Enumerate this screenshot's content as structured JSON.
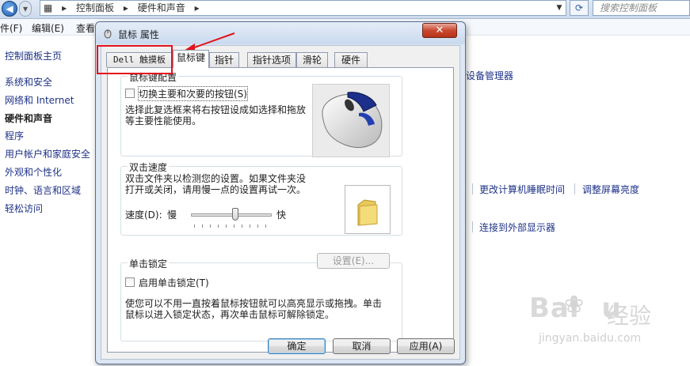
{
  "explorer": {
    "address_segments": [
      "控制面板",
      "▸",
      "硬件和声音",
      "▸"
    ],
    "search_placeholder": "搜索控制面板",
    "menu": [
      "件(F)",
      "编辑(E)",
      "查看"
    ],
    "left_nav": [
      {
        "label": "控制面板主页",
        "bold": false
      },
      {
        "label": "系统和安全",
        "bold": false
      },
      {
        "label": "网络和 Internet",
        "bold": false
      },
      {
        "label": "硬件和声音",
        "bold": true
      },
      {
        "label": "程序",
        "bold": false
      },
      {
        "label": "用户帐户和家庭安全",
        "bold": false
      },
      {
        "label": "外观和个性化",
        "bold": false
      },
      {
        "label": "时钟、语言和区域",
        "bold": false
      },
      {
        "label": "轻松访问",
        "bold": false
      }
    ],
    "right_links": {
      "device_manager": "设备管理器",
      "sleep_time": "更改计算机睡眠时间",
      "brightness": "调整屏幕亮度",
      "external_display": "连接到外部显示器"
    }
  },
  "dialog": {
    "title": "鼠标 属性",
    "close_label": "✕",
    "tabs": [
      {
        "label": "Dell 触摸板",
        "active": false
      },
      {
        "label": "鼠标键",
        "active": true
      },
      {
        "label": "指针",
        "active": false
      },
      {
        "label": "指针选项",
        "active": false
      },
      {
        "label": "滑轮",
        "active": false
      },
      {
        "label": "硬件",
        "active": false
      }
    ],
    "button_config": {
      "group_title": "鼠标键配置",
      "checkbox_label": "切换主要和次要的按钮(S)",
      "checked": false,
      "description_lines": [
        "选择此复选框来将右按钮设成如选择和拖放",
        "等主要性能使用。"
      ]
    },
    "double_click": {
      "group_title": "双击速度",
      "description_lines": [
        "双击文件夹以检测您的设置。如果文件夹没",
        "打开或关闭，请用慢一点的设置再试一次。"
      ],
      "speed_label": "速度(D):",
      "slow_label": "慢",
      "fast_label": "快",
      "speed_fraction": 0.55
    },
    "click_lock": {
      "group_title": "单击锁定",
      "checkbox_label": "启用单击锁定(T)",
      "checked": false,
      "settings_button": "设置(E)...",
      "description_lines": [
        "使您可以不用一直按着鼠标按钮就可以高亮显示或拖拽。单击",
        "鼠标以进入锁定状态，再次单击鼠标可解除锁定。"
      ]
    },
    "buttons": {
      "ok": "确定",
      "cancel": "取消",
      "apply": "应用(A)"
    }
  },
  "watermark": {
    "logo": "Bai",
    "logo_tail": "u",
    "paw": "❀",
    "text": "经验",
    "url": "jingyan.baidu.com"
  },
  "annotation_color": "#e3131b"
}
